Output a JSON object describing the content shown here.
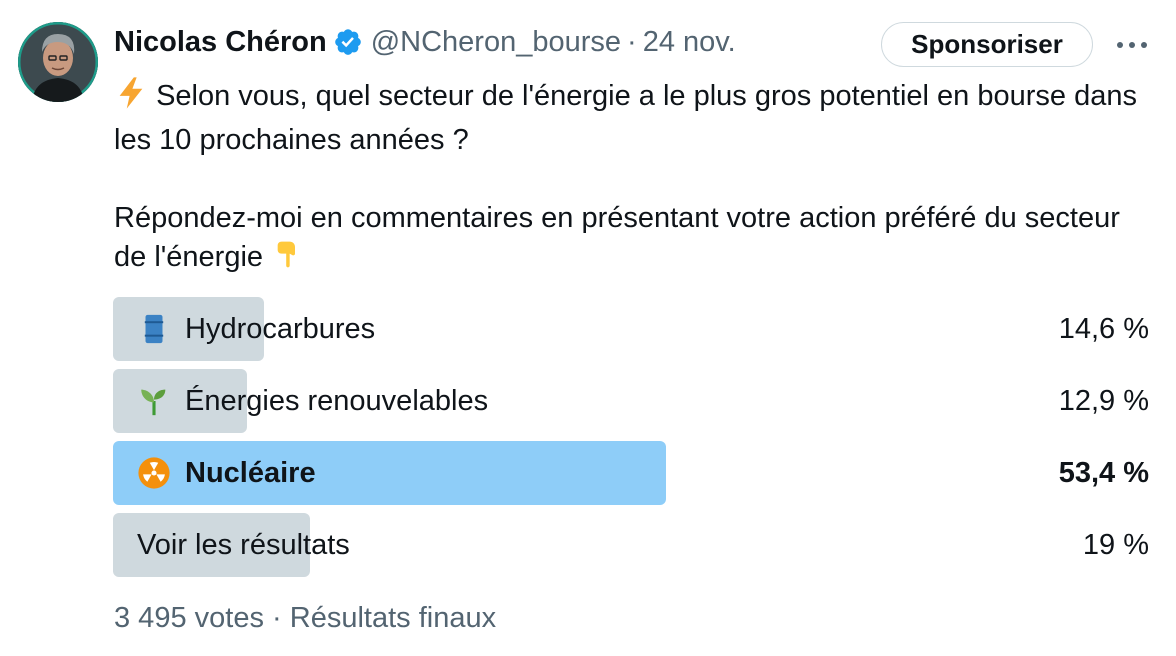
{
  "author": {
    "display_name": "Nicolas Chéron",
    "handle": "@NCheron_bourse",
    "separator": "·",
    "date": "24 nov.",
    "verified_icon": "verified-badge-icon",
    "verified_color": "#1d9bf0"
  },
  "actions": {
    "sponsor_label": "Sponsoriser",
    "more_icon": "more-dots-icon"
  },
  "tweet": {
    "lead_emoji": "⚡",
    "paragraph1": "Selon vous, quel secteur de l'énergie a le plus gros potentiel en bourse dans les 10 prochaines années ?",
    "paragraph2": "Répondez-moi en commentaires en présentant votre action préféré du secteur de l'énergie",
    "trail_emoji": "👇"
  },
  "poll": {
    "options": [
      {
        "label": "Hydrocarbures",
        "percent_text": "14,6 %",
        "percent": 14.6,
        "icon": "oil-drum-icon",
        "winner": false
      },
      {
        "label": "Énergies renouvelables",
        "percent_text": "12,9 %",
        "percent": 12.9,
        "icon": "seedling-icon",
        "winner": false
      },
      {
        "label": "Nucléaire",
        "percent_text": "53,4 %",
        "percent": 53.4,
        "icon": "radioactive-icon",
        "winner": true
      },
      {
        "label": "Voir les résultats",
        "percent_text": "19 %",
        "percent": 19,
        "icon": "",
        "winner": false
      }
    ],
    "bar_color": "#cfd9de",
    "winner_color": "#8ecdf8",
    "votes": "3 495 votes",
    "separator": "·",
    "status": "Résultats finaux"
  }
}
